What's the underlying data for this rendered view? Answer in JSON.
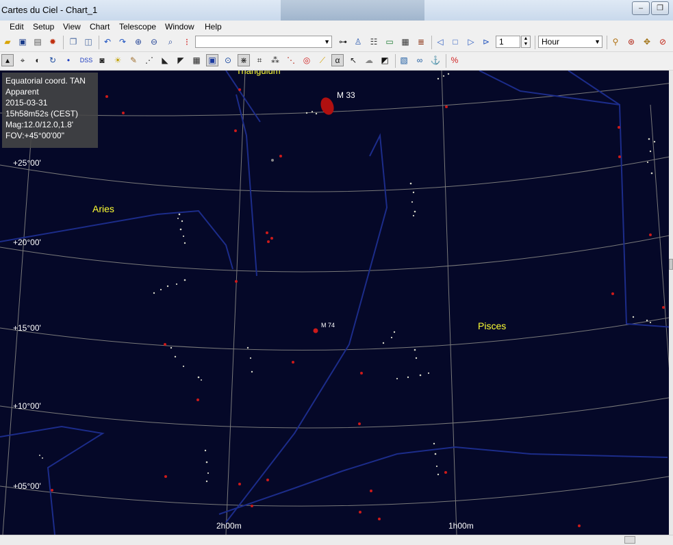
{
  "window": {
    "title": "Cartes du Ciel - Chart_1",
    "minimize": "–",
    "restore": "❐"
  },
  "menu": [
    "Edit",
    "Setup",
    "View",
    "Chart",
    "Telescope",
    "Window",
    "Help"
  ],
  "toolbar": {
    "object_search_value": "",
    "step_value": "1",
    "time_unit": "Hour"
  },
  "info": {
    "projection": "Equatorial coord. TAN",
    "mode": "Apparent",
    "date": "2015-03-31",
    "time": "15h58m52s (CEST)",
    "magnitude": "Mag:12.0/12.0,1.8'",
    "fov": "FOV:+45°00'00\""
  },
  "sky": {
    "dec_labels": [
      "+25°00'",
      "+20°00'",
      "+15°00'",
      "+10°00'",
      "+05°00'"
    ],
    "ra_labels": [
      "2h00m",
      "1h00m"
    ],
    "constellations": [
      "Aries",
      "Pisces",
      "Triangulum"
    ],
    "objects": [
      "M 33",
      "M 74"
    ]
  },
  "colors": {
    "sky": "#050828",
    "constellation_label": "#ffff33",
    "boundary": "#1c2c8a",
    "grid": "#7a7a7a"
  }
}
